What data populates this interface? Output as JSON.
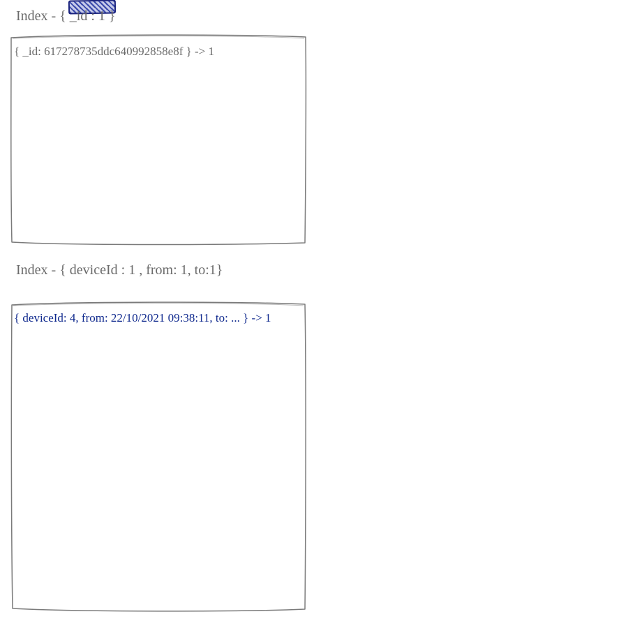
{
  "badge": {
    "present": true
  },
  "index1": {
    "label": "Index - { _id : 1 }",
    "entry": "{ _id: 617278735ddc640992858e8f } -> 1"
  },
  "index2": {
    "label": "Index - { deviceId : 1 , from: 1, to:1}",
    "entry": "{ deviceId: 4, from: 22/10/2021 09:38:11, to: ... } -> 1"
  }
}
